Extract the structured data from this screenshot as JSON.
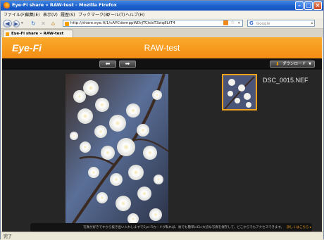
{
  "window": {
    "title": "Eye-Fi share » RAW-test - Mozilla Firefox"
  },
  "menu": [
    "ファイル(F)",
    "編集(E)",
    "表示(V)",
    "履歴(S)",
    "ブックマーク(B)",
    "ツール(T)",
    "ヘルプ(H)"
  ],
  "urlbar": {
    "value": "http://share.eye.fi/1/cAPCdemppWDrJTCtdsT3ziq8LtT4"
  },
  "search": {
    "placeholder": "Google"
  },
  "tab": {
    "label": "Eye-Fi share » RAW-test"
  },
  "page": {
    "logo": "Eye-Fi",
    "album_title": "RAW-test",
    "download_label": "ダウンロード",
    "filename": "DSC_0015.NEF",
    "footer_text": "写真が好きですから抜き出い入れしますでEye-Fiカードが私れば、後でも簡単にEに大切な写真を保存して、どこからでもアクセスできます。",
    "footer_link": "詳しくはこちら ▸"
  },
  "status": {
    "text": "完了"
  },
  "icons": {
    "back": "back-arrow-icon",
    "forward": "forward-arrow-icon",
    "reload": "reload-icon",
    "stop": "stop-icon",
    "home": "home-icon",
    "rss": "rss-icon",
    "star": "bookmark-star-icon",
    "search": "magnifier-icon",
    "download": "download-icon",
    "prev": "prev-arrow-icon",
    "next": "next-arrow-icon"
  },
  "colors": {
    "accent": "#f39a18",
    "page_bg": "#262626",
    "header": "#f49512"
  }
}
